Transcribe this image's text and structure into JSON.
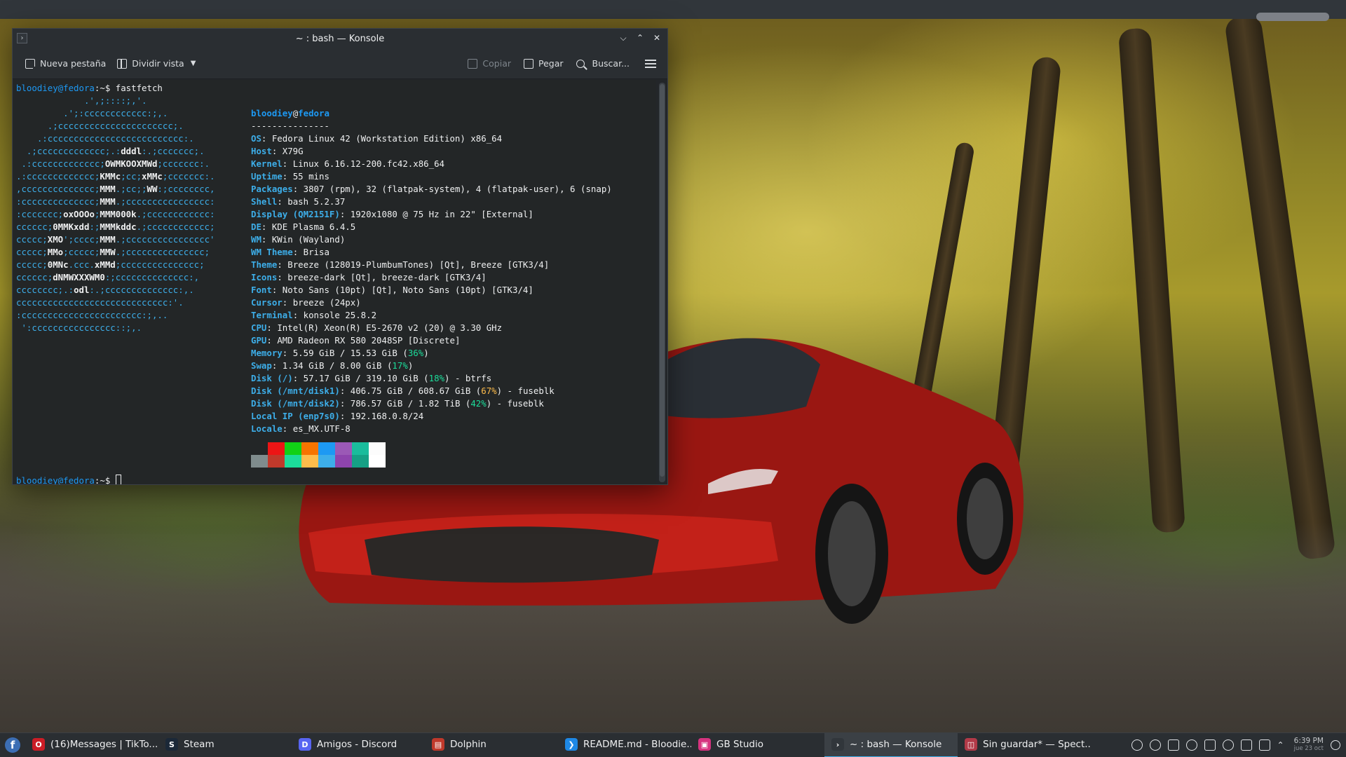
{
  "window": {
    "title": "~ : bash — Konsole",
    "title_icon": "terminal-icon"
  },
  "toolbar": {
    "new_tab": "Nueva pestaña",
    "split_view": "Dividir vista",
    "copy": "Copiar",
    "paste": "Pegar",
    "search": "Buscar..."
  },
  "terminal": {
    "prompt_user": "bloodiey@fedora",
    "prompt_suffix": ":~$ ",
    "command": "fastfetch",
    "logo_lines": [
      "             .',;::::;,'.",
      "         .';:cccccccccccc:;,.",
      "      .;cccccccccccccccccccccc;.",
      "    .:cccccccccccccccccccccccccc:.",
      "  .;ccccccccccccc;.:dddl:.;ccccccc;.",
      " .:ccccccccccccc;OWMKOOXMWd;ccccccc:.",
      ".:ccccccccccccc;KMMc;cc;xMMc;ccccccc:.",
      ",cccccccccccccc;MMM.;cc;;WW:;cccccccc,",
      ":cccccccccccccc;MMM.;cccccccccccccccc:",
      ":ccccccc;oxOOOo;MMM000k.;cccccccccccc:",
      "cccccc;0MMKxdd:;MMMkddc.;cccccccccccc;",
      "ccccc;XMO';cccc;MMM.;cccccccccccccccc'",
      "ccccc;MMo;ccccc;MMW.;ccccccccccccccc;",
      "ccccc;0MNc.ccc.xMMd;ccccccccccccccc;",
      "cccccc;dNMWXXXWM0:;cccccccccccccc:,",
      "cccccccc;.:odl:.;cccccccccccccc:,.",
      "ccccccccccccccccccccccccccccc:'.",
      ":ccccccccccccccccccccccc:;,..",
      " ':cccccccccccccccc::;,."
    ],
    "header_user": "bloodiey",
    "header_at": "@",
    "header_host": "fedora",
    "separator": "---------------",
    "info": [
      {
        "key": "OS",
        "value": "Fedora Linux 42 (Workstation Edition) x86_64"
      },
      {
        "key": "Host",
        "value": "X79G"
      },
      {
        "key": "Kernel",
        "value": "Linux 6.16.12-200.fc42.x86_64"
      },
      {
        "key": "Uptime",
        "value": "55 mins"
      },
      {
        "key": "Packages",
        "value": "3807 (rpm), 32 (flatpak-system), 4 (flatpak-user), 6 (snap)"
      },
      {
        "key": "Shell",
        "value": "bash 5.2.37"
      },
      {
        "key": "Display (QM2151F)",
        "value": "1920x1080 @ 75 Hz in 22\" [External]"
      },
      {
        "key": "DE",
        "value": "KDE Plasma 6.4.5"
      },
      {
        "key": "WM",
        "value": "KWin (Wayland)"
      },
      {
        "key": "WM Theme",
        "value": "Brisa"
      },
      {
        "key": "Theme",
        "value": "Breeze (128019-PlumbumTones) [Qt], Breeze [GTK3/4]"
      },
      {
        "key": "Icons",
        "value": "breeze-dark [Qt], breeze-dark [GTK3/4]"
      },
      {
        "key": "Font",
        "value": "Noto Sans (10pt) [Qt], Noto Sans (10pt) [GTK3/4]"
      },
      {
        "key": "Cursor",
        "value": "breeze (24px)"
      },
      {
        "key": "Terminal",
        "value": "konsole 25.8.2"
      },
      {
        "key": "CPU",
        "value": "Intel(R) Xeon(R) E5-2670 v2 (20) @ 3.30 GHz"
      },
      {
        "key": "GPU",
        "value": "AMD Radeon RX 580 2048SP [Discrete]"
      },
      {
        "key": "Memory",
        "pre": "5.59 GiB / 15.53 GiB (",
        "pct": "36%",
        "post": ")",
        "pct_color": "green"
      },
      {
        "key": "Swap",
        "pre": "1.34 GiB / 8.00 GiB (",
        "pct": "17%",
        "post": ")",
        "pct_color": "green"
      },
      {
        "key": "Disk (/)",
        "pre": "57.17 GiB / 319.10 GiB (",
        "pct": "18%",
        "post": ") - btrfs",
        "pct_color": "green"
      },
      {
        "key": "Disk (/mnt/disk1)",
        "pre": "406.75 GiB / 608.67 GiB (",
        "pct": "67%",
        "post": ") - fuseblk",
        "pct_color": "yellow"
      },
      {
        "key": "Disk (/mnt/disk2)",
        "pre": "786.57 GiB / 1.82 TiB (",
        "pct": "42%",
        "post": ") - fuseblk",
        "pct_color": "green"
      },
      {
        "key": "Local IP (enp7s0)",
        "value": "192.168.0.8/24"
      },
      {
        "key": "Locale",
        "value": "es_MX.UTF-8"
      }
    ],
    "palette_top": [
      "#232627",
      "#ed1515",
      "#11d116",
      "#f67400",
      "#1d99f3",
      "#9b59b6",
      "#1abc9c",
      "#fcfcfc"
    ],
    "palette_bottom": [
      "#7f8c8d",
      "#c0392b",
      "#1cdc9a",
      "#fdbc4b",
      "#3daee9",
      "#8e44ad",
      "#16a085",
      "#ffffff"
    ]
  },
  "taskbar": {
    "launcher_icon": "fedora-logo-icon",
    "tasks": [
      {
        "label": "(16)Messages | TikTo...",
        "icon": "opera-icon",
        "color": "#cc1d26",
        "glyph": "O"
      },
      {
        "label": "Steam",
        "icon": "steam-icon",
        "color": "#1b2838",
        "glyph": "S"
      },
      {
        "label": "Amigos - Discord",
        "icon": "discord-icon",
        "color": "#5865f2",
        "glyph": "D"
      },
      {
        "label": "Dolphin",
        "icon": "dolphin-icon",
        "color": "#c0392b",
        "glyph": "▤"
      },
      {
        "label": "README.md - Bloodie...",
        "icon": "vscode-icon",
        "color": "#1e88e5",
        "glyph": "❯"
      },
      {
        "label": "GB Studio",
        "icon": "gb-studio-icon",
        "color": "#d6337f",
        "glyph": "▣"
      },
      {
        "label": "~ : bash — Konsole",
        "icon": "konsole-icon",
        "color": "#31363b",
        "glyph": "›",
        "active": true
      },
      {
        "label": "Sin guardar* — Spect...",
        "icon": "spectacle-icon",
        "color": "#b23a48",
        "glyph": "◫"
      }
    ],
    "clock_time": "6:39 PM",
    "clock_date": "jue 23 oct"
  },
  "colors": {
    "accent": "#3daee9",
    "terminal_bg": "#232627",
    "panel_bg": "#2a2e32"
  }
}
